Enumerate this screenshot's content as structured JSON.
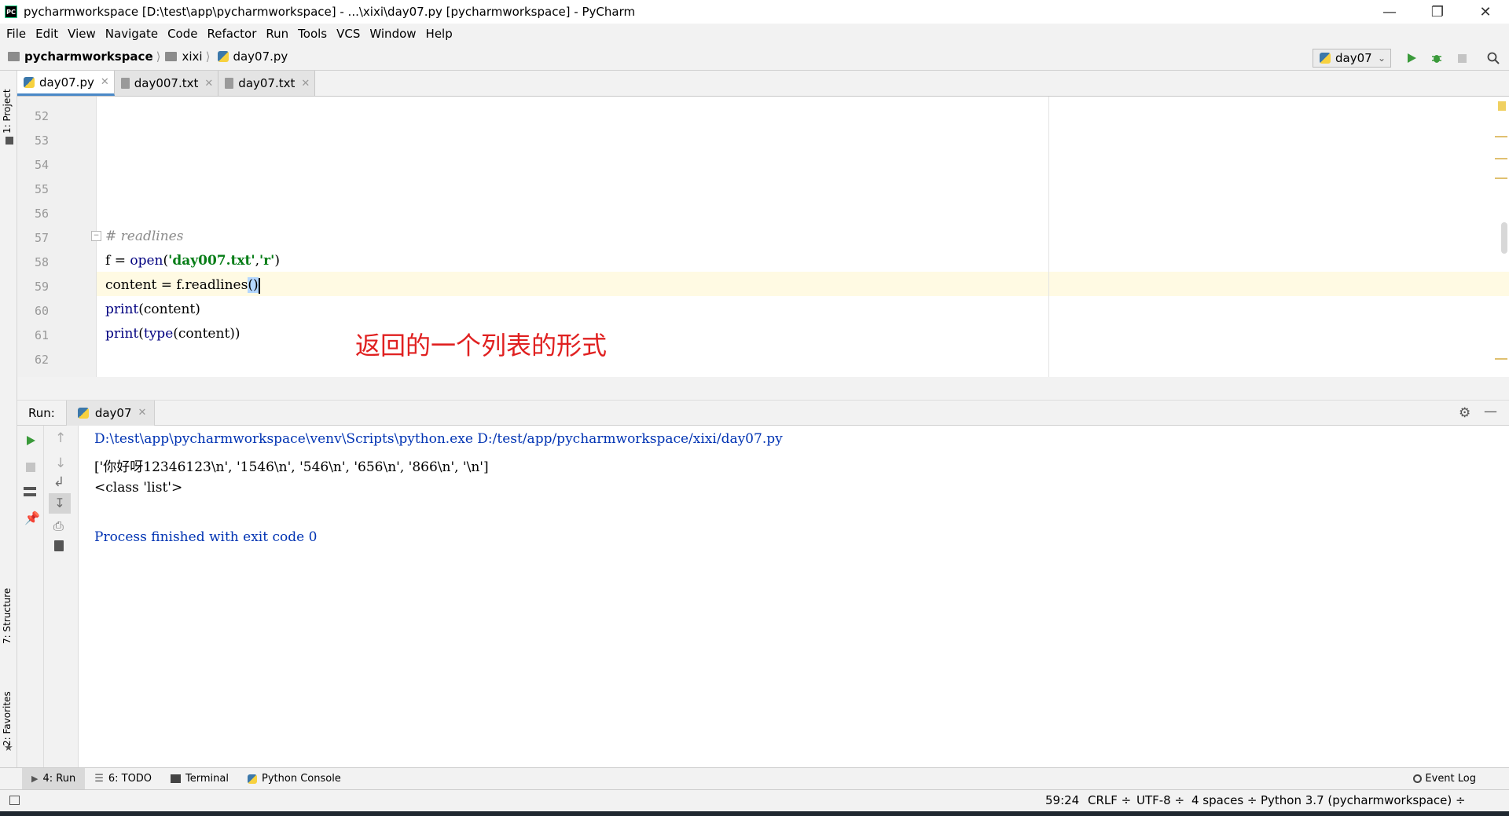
{
  "window": {
    "title": "pycharmworkspace [D:\\test\\app\\pycharmworkspace] - ...\\xixi\\day07.py [pycharmworkspace] - PyCharm",
    "app_icon_text": "PC"
  },
  "menu": [
    "File",
    "Edit",
    "View",
    "Navigate",
    "Code",
    "Refactor",
    "Run",
    "Tools",
    "VCS",
    "Window",
    "Help"
  ],
  "breadcrumb": {
    "project": "pycharmworkspace",
    "folder": "xixi",
    "file": "day07.py"
  },
  "run_config": "day07",
  "left_strip": {
    "project": "1: Project",
    "structure": "7: Structure",
    "favorites": "2: Favorites"
  },
  "editor_tabs": [
    {
      "label": "day07.py",
      "active": true
    },
    {
      "label": "day007.txt",
      "active": false
    },
    {
      "label": "day07.txt",
      "active": false
    }
  ],
  "editor": {
    "line_numbers": [
      "52",
      "53",
      "54",
      "55",
      "56",
      "57",
      "58",
      "59",
      "60",
      "61",
      "62"
    ],
    "comment": "# readlines",
    "line58": {
      "a": "f = ",
      "b": "open",
      "c": "(",
      "d": "'day007.txt'",
      "e": ",",
      "f": "'r'",
      "g": ")"
    },
    "line59": {
      "a": "content = f.readlines",
      "b": "()"
    },
    "line60": {
      "a": "print",
      "b": "(content)"
    },
    "line61": {
      "a": "print",
      "b": "(",
      "c": "type",
      "d": "(content))"
    },
    "annotation": "返回的一个列表的形式"
  },
  "run_panel": {
    "label": "Run:",
    "tab": "day07",
    "console": [
      "D:\\test\\app\\pycharmworkspace\\venv\\Scripts\\python.exe D:/test/app/pycharmworkspace/xixi/day07.py",
      "['你好呀12346123\\n', '1546\\n', '546\\n', '656\\n', '866\\n', '\\n']",
      "<class 'list'>",
      "",
      "Process finished with exit code 0"
    ]
  },
  "bottom_tools": [
    {
      "label": "4: Run",
      "icon": "run-icon"
    },
    {
      "label": "6: TODO",
      "icon": "list-icon"
    },
    {
      "label": "Terminal",
      "icon": "terminal-icon"
    },
    {
      "label": "Python Console",
      "icon": "python-console-icon"
    }
  ],
  "event_log": "Event Log",
  "status": {
    "position": "59:24",
    "line_sep": "CRLF ÷",
    "encoding": "UTF-8 ÷",
    "indent": "4 spaces ÷",
    "interpreter": "Python 3.7 (pycharmworkspace) ÷"
  },
  "colors": {
    "accent_green": "#3a9a3a",
    "console_blue": "#0033b3",
    "annotation_red": "#e02020"
  }
}
